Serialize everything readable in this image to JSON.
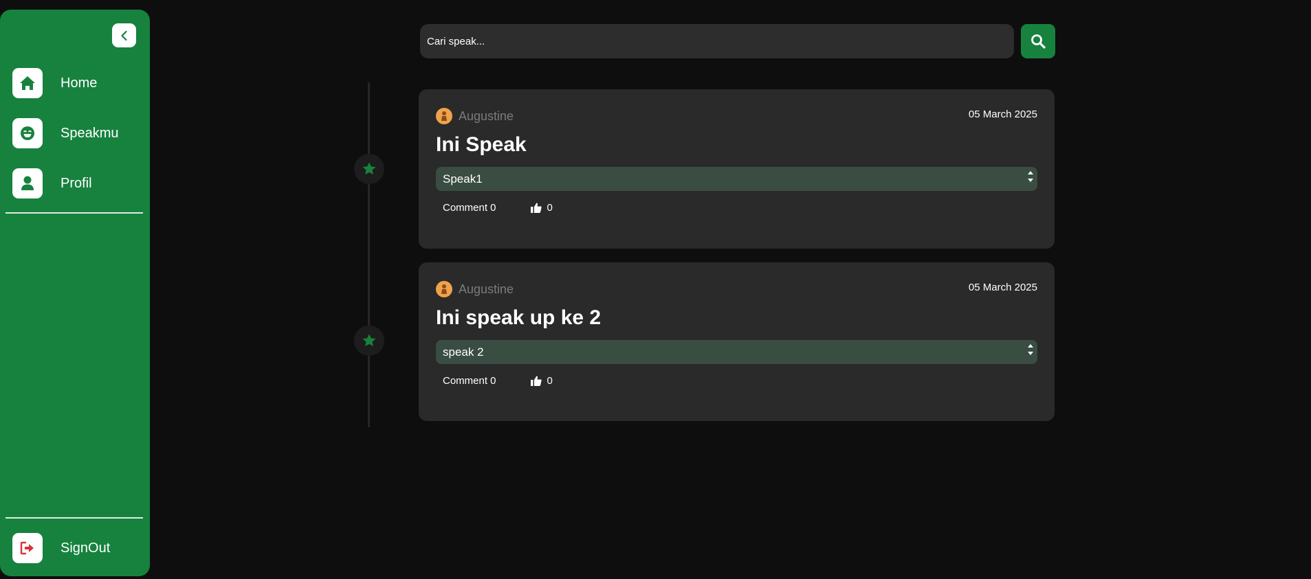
{
  "sidebar": {
    "items": [
      {
        "label": "Home",
        "icon": "home-icon"
      },
      {
        "label": "Speakmu",
        "icon": "smile-icon"
      },
      {
        "label": "Profil",
        "icon": "user-icon"
      }
    ],
    "signout_label": "SignOut"
  },
  "search": {
    "placeholder": "Cari speak..."
  },
  "posts": [
    {
      "author": "Augustine",
      "date": "05 March 2025",
      "title": "Ini Speak",
      "speak": "Speak1",
      "comment_label": "Comment 0",
      "likes": "0"
    },
    {
      "author": "Augustine",
      "date": "05 March 2025",
      "title": "Ini speak up ke 2",
      "speak": "speak 2",
      "comment_label": "Comment 0",
      "likes": "0"
    }
  ],
  "colors": {
    "brand": "#17823e",
    "background": "#0e0e0e",
    "card": "#2a2a2a",
    "signout": "#d9323b"
  }
}
